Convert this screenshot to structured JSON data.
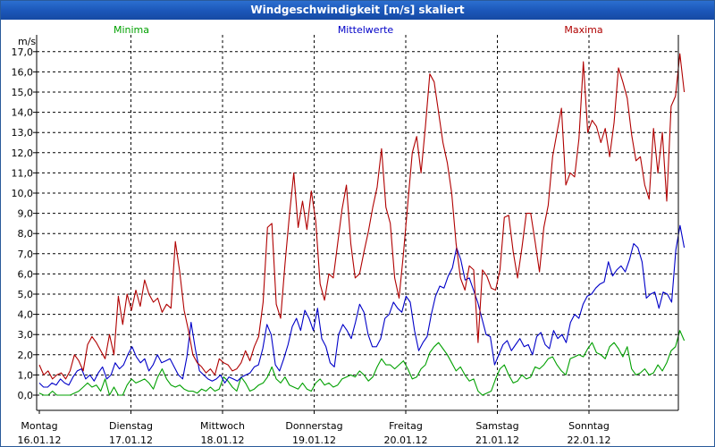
{
  "window": {
    "title": "Windgeschwindigkeit [m/s] skaliert"
  },
  "chart_data": {
    "type": "line",
    "title": "Windgeschwindigkeit [m/s] skaliert",
    "ylabel": "m/s",
    "ylim": [
      0,
      17.5
    ],
    "grid": true,
    "legend_position": "top",
    "y_ticks": [
      "0,0",
      "1,0",
      "2,0",
      "3,0",
      "4,0",
      "5,0",
      "6,0",
      "7,0",
      "8,0",
      "9,0",
      "10,0",
      "11,0",
      "12,0",
      "13,0",
      "14,0",
      "15,0",
      "16,0",
      "17,0"
    ],
    "x_range_days": [
      0,
      7.04
    ],
    "x_labels": [
      {
        "day": "Montag",
        "date": "16.01.12"
      },
      {
        "day": "Dienstag",
        "date": "17.01.12"
      },
      {
        "day": "Mittwoch",
        "date": "18.01.12"
      },
      {
        "day": "Donnerstag",
        "date": "19.01.12"
      },
      {
        "day": "Freitag",
        "date": "20.01.12"
      },
      {
        "day": "Samstag",
        "date": "21.01.12"
      },
      {
        "day": "Sonntag",
        "date": "22.01.12"
      }
    ],
    "series": [
      {
        "name": "Minima",
        "color": "#00a000",
        "values": [
          0.1,
          0.0,
          0.0,
          0.2,
          0.0,
          0.0,
          0.0,
          0.0,
          0.1,
          0.2,
          0.4,
          0.6,
          0.4,
          0.5,
          0.2,
          0.8,
          0.0,
          0.4,
          0.0,
          0.0,
          0.5,
          0.8,
          0.6,
          0.7,
          0.8,
          0.6,
          0.3,
          0.9,
          1.3,
          0.8,
          0.5,
          0.4,
          0.5,
          0.3,
          0.2,
          0.2,
          0.1,
          0.3,
          0.2,
          0.4,
          0.2,
          0.3,
          0.9,
          0.7,
          0.4,
          0.2,
          0.9,
          0.6,
          0.2,
          0.3,
          0.5,
          0.6,
          0.9,
          1.4,
          0.8,
          0.6,
          0.9,
          0.5,
          0.4,
          0.3,
          0.6,
          0.3,
          0.2,
          0.6,
          0.8,
          0.5,
          0.6,
          0.4,
          0.5,
          0.8,
          0.9,
          1.0,
          0.9,
          1.2,
          1.0,
          0.7,
          0.9,
          1.4,
          1.8,
          1.5,
          1.5,
          1.3,
          1.5,
          1.7,
          1.3,
          0.8,
          0.9,
          1.3,
          1.5,
          2.1,
          2.4,
          2.6,
          2.3,
          2.0,
          1.6,
          1.2,
          1.4,
          1.0,
          0.7,
          0.8,
          0.2,
          0.0,
          0.1,
          0.2,
          0.8,
          1.3,
          1.5,
          1.0,
          0.6,
          0.7,
          1.0,
          0.8,
          0.9,
          1.4,
          1.3,
          1.5,
          1.8,
          1.9,
          1.5,
          1.2,
          1.0,
          1.8,
          1.9,
          2.0,
          1.9,
          2.3,
          2.6,
          2.1,
          2.0,
          1.8,
          2.4,
          2.6,
          2.3,
          1.9,
          2.4,
          1.3,
          1.0,
          1.1,
          1.3,
          1.0,
          1.1,
          1.5,
          1.2,
          1.6,
          2.2,
          2.4,
          3.2,
          2.7
        ]
      },
      {
        "name": "Mittelwerte",
        "color": "#0000c8",
        "values": [
          0.6,
          0.4,
          0.4,
          0.6,
          0.5,
          0.8,
          0.6,
          0.5,
          0.9,
          1.2,
          1.3,
          0.8,
          1.0,
          0.7,
          1.1,
          1.4,
          0.8,
          1.0,
          1.6,
          1.3,
          1.5,
          2.0,
          2.4,
          1.9,
          1.6,
          1.8,
          1.2,
          1.5,
          2.0,
          1.6,
          1.7,
          1.8,
          1.4,
          1.0,
          0.8,
          1.9,
          3.6,
          2.3,
          1.2,
          1.0,
          0.8,
          0.7,
          0.8,
          1.0,
          0.6,
          0.9,
          0.8,
          0.7,
          0.9,
          1.0,
          1.1,
          1.4,
          1.5,
          2.3,
          3.5,
          3.0,
          1.5,
          1.2,
          1.8,
          2.5,
          3.4,
          3.8,
          3.2,
          4.2,
          3.8,
          3.2,
          4.3,
          2.8,
          2.4,
          1.6,
          1.4,
          3.0,
          3.5,
          3.2,
          2.8,
          3.6,
          4.5,
          4.1,
          3.0,
          2.4,
          2.4,
          2.8,
          3.8,
          4.0,
          4.6,
          4.3,
          4.1,
          4.9,
          4.6,
          3.2,
          2.2,
          2.6,
          2.9,
          4.0,
          4.9,
          5.4,
          5.3,
          5.9,
          6.3,
          7.3,
          6.7,
          5.7,
          5.8,
          5.2,
          4.6,
          3.8,
          3.0,
          2.9,
          1.5,
          2.0,
          2.5,
          2.7,
          2.2,
          2.5,
          2.8,
          2.4,
          2.5,
          2.0,
          2.9,
          3.1,
          2.5,
          2.3,
          3.2,
          2.8,
          3.0,
          2.6,
          3.6,
          4.0,
          3.8,
          4.5,
          4.9,
          5.0,
          5.3,
          5.5,
          5.6,
          6.6,
          5.9,
          6.2,
          6.4,
          6.1,
          6.7,
          7.5,
          7.3,
          6.6,
          4.8,
          5.0,
          5.1,
          4.3,
          5.1,
          5.0,
          4.6,
          7.2,
          8.4,
          7.3
        ]
      },
      {
        "name": "Maxima",
        "color": "#b00000",
        "values": [
          1.5,
          1.0,
          1.2,
          0.8,
          1.0,
          1.1,
          0.8,
          1.2,
          2.0,
          1.7,
          1.2,
          2.5,
          2.9,
          2.6,
          2.2,
          1.8,
          3.0,
          2.0,
          4.9,
          3.5,
          5.0,
          4.2,
          5.2,
          4.4,
          5.7,
          5.0,
          4.6,
          4.8,
          4.1,
          4.5,
          4.3,
          7.6,
          6.1,
          4.2,
          3.2,
          2.0,
          1.6,
          1.4,
          1.1,
          1.3,
          1.0,
          1.8,
          1.6,
          1.5,
          1.2,
          1.3,
          1.6,
          2.2,
          1.7,
          2.4,
          2.9,
          4.6,
          8.3,
          8.5,
          4.5,
          3.8,
          6.5,
          8.9,
          11.0,
          8.3,
          9.6,
          8.2,
          10.1,
          8.6,
          5.5,
          4.7,
          6.0,
          5.8,
          7.5,
          9.2,
          10.4,
          7.5,
          5.8,
          6.0,
          7.1,
          8.1,
          9.3,
          10.3,
          12.2,
          9.3,
          8.5,
          5.8,
          4.8,
          7.0,
          9.5,
          12.0,
          12.8,
          11.0,
          13.3,
          15.9,
          15.5,
          14.0,
          12.5,
          11.5,
          10.0,
          7.5,
          5.8,
          5.2,
          6.4,
          6.2,
          2.6,
          6.2,
          5.9,
          5.3,
          5.2,
          6.2,
          8.8,
          8.9,
          7.1,
          5.8,
          7.3,
          9.0,
          9.0,
          7.6,
          6.1,
          8.3,
          9.4,
          11.8,
          13.0,
          14.2,
          10.4,
          11.0,
          10.8,
          12.7,
          16.5,
          13.0,
          13.6,
          13.3,
          12.5,
          13.2,
          11.8,
          13.5,
          16.2,
          15.5,
          14.7,
          12.9,
          11.6,
          11.8,
          10.4,
          9.7,
          13.2,
          11.0,
          13.0,
          9.6,
          14.3,
          14.8,
          16.9,
          15.0
        ]
      }
    ]
  }
}
